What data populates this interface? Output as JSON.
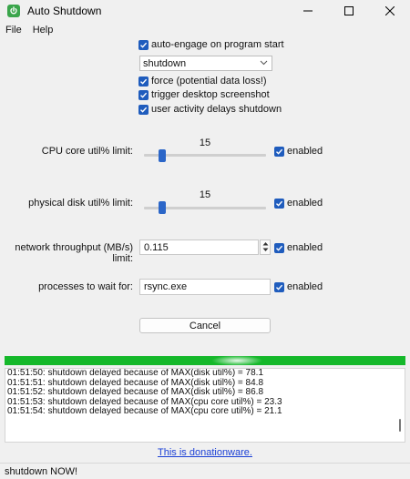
{
  "window": {
    "title": "Auto Shutdown"
  },
  "menu": [
    "File",
    "Help"
  ],
  "options": {
    "auto_engage": "auto-engage on program start",
    "action_value": "shutdown",
    "force": "force (potential data loss!)",
    "screenshot": "trigger desktop screenshot",
    "user_activity": "user activity delays shutdown"
  },
  "cpu": {
    "label": "CPU core util% limit:",
    "value": "15",
    "enabled": "enabled",
    "level_fraction": 0.15
  },
  "disk": {
    "label": "physical disk util% limit:",
    "value": "15",
    "enabled": "enabled",
    "level_fraction": 0.15
  },
  "network": {
    "label": "network throughput (MB/s) limit:",
    "value": "0.115",
    "enabled": "enabled"
  },
  "processes": {
    "label": "processes to wait for:",
    "value": "rsync.exe",
    "enabled": "enabled"
  },
  "cancel_label": "Cancel",
  "progress_fraction": 1.0,
  "log": [
    "01:51:50: shutdown delayed because of MAX(disk util%) = 78.1",
    "01:51:51: shutdown delayed because of MAX(disk util%) = 84.8",
    "01:51:52: shutdown delayed because of MAX(disk util%) = 86.8",
    "01:51:53: shutdown delayed because of MAX(cpu core util%) = 23.3",
    "01:51:54: shutdown delayed because of MAX(cpu core util%) = 21.1"
  ],
  "donation_link": "This is donationware.",
  "status": "shutdown NOW!",
  "colors": {
    "accent": "#1f5cbd",
    "progress": "#15b82a",
    "link": "#1a3fd6"
  }
}
